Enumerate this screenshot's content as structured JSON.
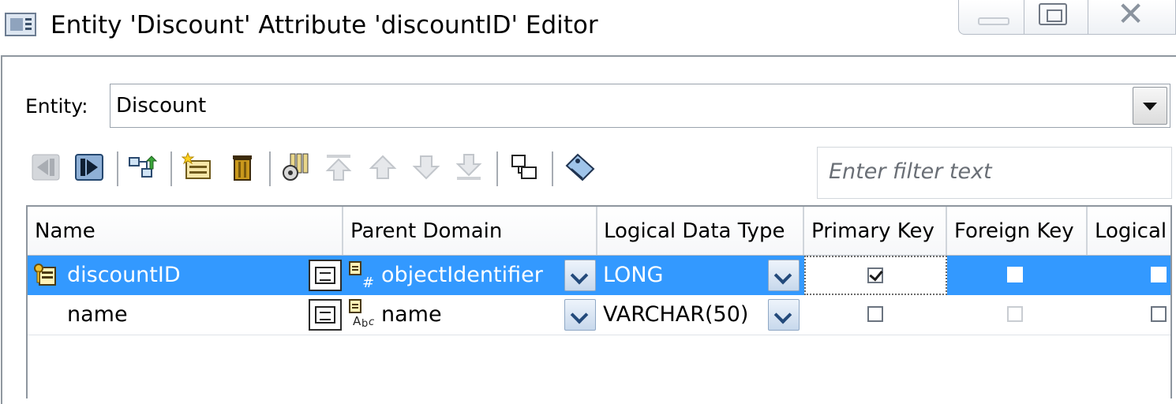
{
  "window": {
    "title": "Entity 'Discount' Attribute 'discountID' Editor",
    "icons": {
      "app": "window-app-icon",
      "minimize": "minimize-icon",
      "maximize": "maximize-icon",
      "close": "close-icon"
    }
  },
  "entity": {
    "label": "Entity:",
    "value": "Discount"
  },
  "toolbar": {
    "buttons": [
      {
        "name": "collapse-left-icon",
        "enabled": false
      },
      {
        "name": "expand-right-icon",
        "enabled": true
      },
      {
        "name": "hierarchy-icon",
        "enabled": true
      },
      {
        "name": "new-attribute-icon",
        "enabled": true
      },
      {
        "name": "delete-icon",
        "enabled": true
      },
      {
        "name": "column-properties-icon",
        "enabled": true
      },
      {
        "name": "move-to-top-icon",
        "enabled": false
      },
      {
        "name": "move-up-icon",
        "enabled": false
      },
      {
        "name": "move-down-icon",
        "enabled": false
      },
      {
        "name": "move-to-bottom-icon",
        "enabled": false
      },
      {
        "name": "relationship-icon",
        "enabled": true
      },
      {
        "name": "tag-icon",
        "enabled": true
      }
    ],
    "filter_placeholder": "Enter filter text"
  },
  "table": {
    "columns": [
      "Name",
      "Parent Domain",
      "Logical Data Type",
      "Primary Key",
      "Foreign Key",
      "Logical"
    ],
    "rows": [
      {
        "name": "discountID",
        "parent_domain": "objectIdentifier",
        "logical_data_type": "LONG",
        "primary_key": true,
        "foreign_key": false,
        "logical": false,
        "selected": true,
        "key_icon": "primary-key-icon",
        "domain_icon": "numeric-domain-icon"
      },
      {
        "name": "name",
        "parent_domain": "name",
        "logical_data_type": "VARCHAR(50)",
        "primary_key": false,
        "foreign_key": false,
        "logical": false,
        "selected": false,
        "domain_icon": "text-domain-icon"
      }
    ]
  },
  "colors": {
    "selection": "#3399ff",
    "border": "#8f979f"
  }
}
